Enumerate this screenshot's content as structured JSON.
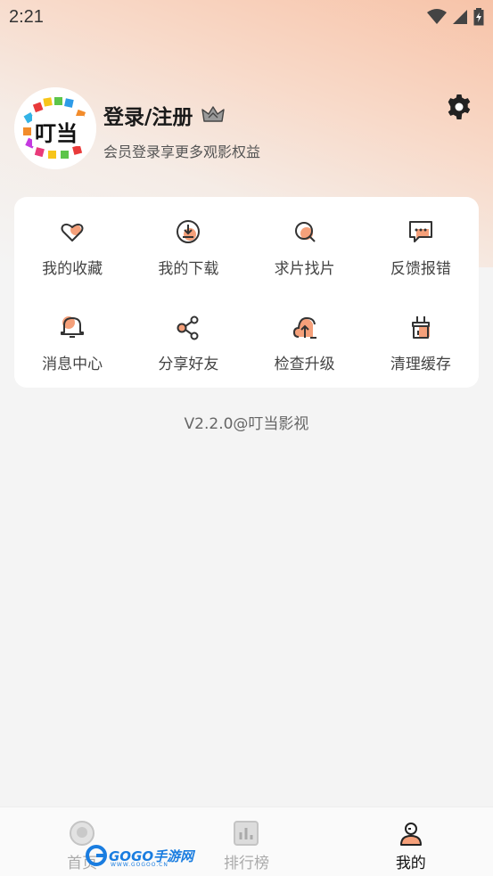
{
  "status_bar": {
    "time": "2:21"
  },
  "profile": {
    "avatar_text": "叮当",
    "title": "登录/注册",
    "subtitle": "会员登录享更多观影权益"
  },
  "menu": [
    {
      "label": "我的收藏",
      "icon": "heart-icon"
    },
    {
      "label": "我的下载",
      "icon": "download-icon"
    },
    {
      "label": "求片找片",
      "icon": "search-movie-icon"
    },
    {
      "label": "反馈报错",
      "icon": "feedback-icon"
    },
    {
      "label": "消息中心",
      "icon": "bell-icon"
    },
    {
      "label": "分享好友",
      "icon": "share-icon"
    },
    {
      "label": "检查升级",
      "icon": "upgrade-icon"
    },
    {
      "label": "清理缓存",
      "icon": "clean-icon"
    }
  ],
  "version": "V2.2.0@叮当影视",
  "tabs": [
    {
      "label": "首页",
      "icon": "home-icon",
      "active": false
    },
    {
      "label": "排行榜",
      "icon": "chart-icon",
      "active": false
    },
    {
      "label": "我的",
      "icon": "user-icon",
      "active": true
    }
  ],
  "watermark": {
    "text": "GOGO手游网",
    "sub": "WWW.GOGOO.CN"
  },
  "colors": {
    "accent": "#f5a07a",
    "icon_stroke": "#333333"
  }
}
